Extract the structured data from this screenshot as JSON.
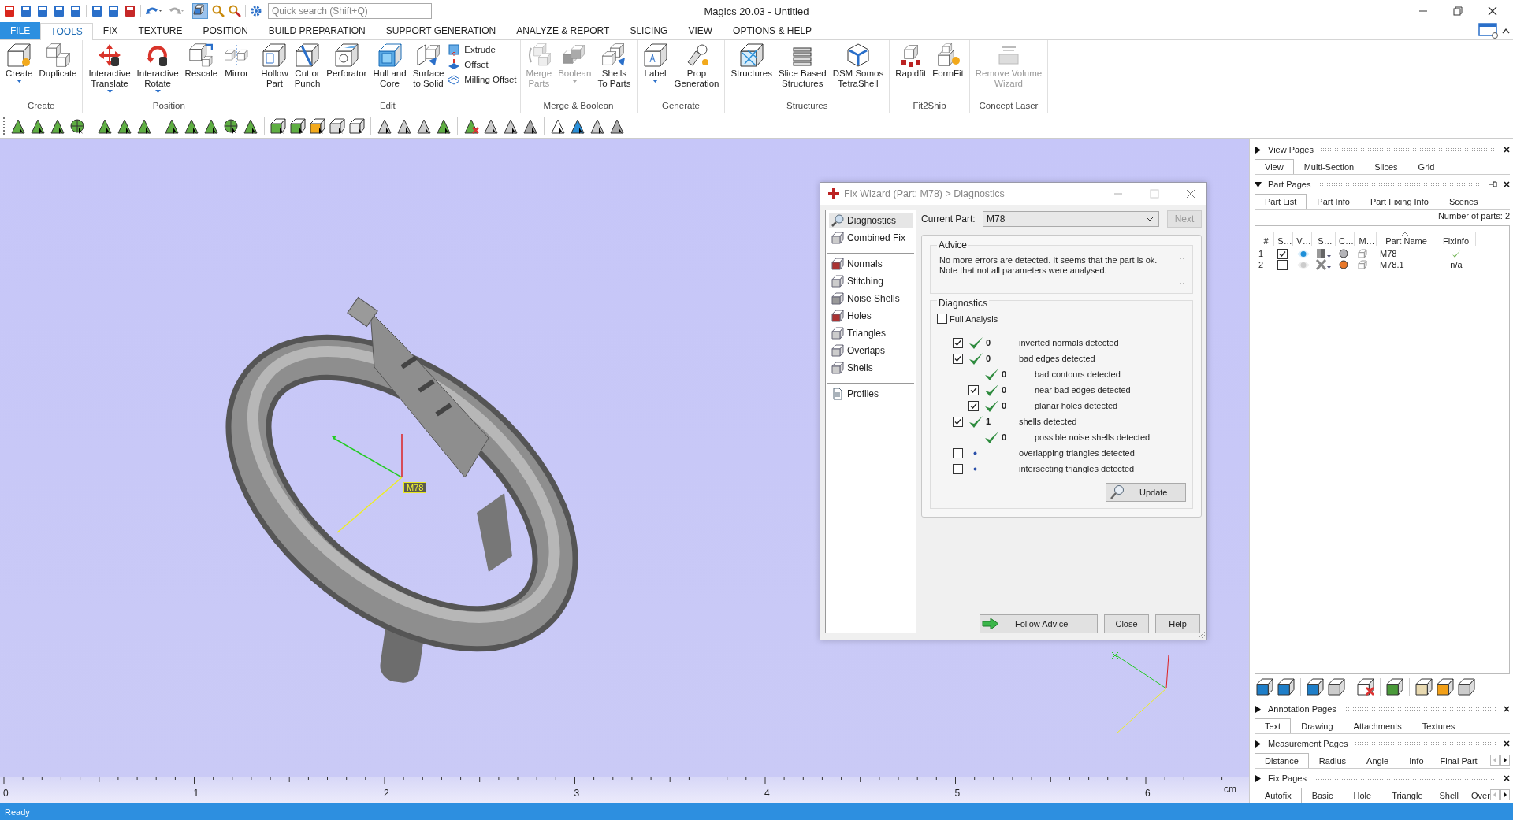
{
  "window": {
    "title": "Magics 20.03 - Untitled"
  },
  "quick_search": {
    "placeholder": "Quick search (Shift+Q)"
  },
  "menu_tabs": [
    {
      "label": "FILE",
      "kind": "file",
      "selected": false
    },
    {
      "label": "TOOLS",
      "kind": "tab",
      "selected": true
    },
    {
      "label": "FIX",
      "kind": "tab",
      "selected": false
    },
    {
      "label": "TEXTURE",
      "kind": "tab",
      "selected": false
    },
    {
      "label": "POSITION",
      "kind": "tab",
      "selected": false
    },
    {
      "label": "BUILD PREPARATION",
      "kind": "tab",
      "selected": false
    },
    {
      "label": "SUPPORT GENERATION",
      "kind": "tab",
      "selected": false
    },
    {
      "label": "ANALYZE & REPORT",
      "kind": "tab",
      "selected": false
    },
    {
      "label": "SLICING",
      "kind": "tab",
      "selected": false
    },
    {
      "label": "VIEW",
      "kind": "tab",
      "selected": false
    },
    {
      "label": "OPTIONS & HELP",
      "kind": "tab",
      "selected": false
    }
  ],
  "ribbon_groups": [
    {
      "label": "Create",
      "buttons": [
        {
          "label": "Create",
          "kind": "large",
          "dropdown": true,
          "disabled": false
        },
        {
          "label": "Duplicate",
          "kind": "large",
          "dropdown": false,
          "disabled": false
        }
      ]
    },
    {
      "label": "Position",
      "buttons": [
        {
          "label": "Interactive\nTranslate",
          "kind": "large",
          "dropdown": true,
          "disabled": false
        },
        {
          "label": "Interactive\nRotate",
          "kind": "large",
          "dropdown": true,
          "disabled": false
        },
        {
          "label": "Rescale",
          "kind": "large",
          "dropdown": false,
          "disabled": false
        },
        {
          "label": "Mirror",
          "kind": "large",
          "dropdown": false,
          "disabled": false
        }
      ]
    },
    {
      "label": "Edit",
      "buttons": [
        {
          "label": "Hollow\nPart",
          "kind": "large",
          "dropdown": false,
          "disabled": false
        },
        {
          "label": "Cut or\nPunch",
          "kind": "large",
          "dropdown": false,
          "disabled": false
        },
        {
          "label": "Perforator",
          "kind": "large",
          "dropdown": false,
          "disabled": false
        },
        {
          "label": "Hull and\nCore",
          "kind": "large",
          "dropdown": false,
          "disabled": false
        },
        {
          "label": "Surface\nto Solid",
          "kind": "large",
          "dropdown": false,
          "disabled": false
        },
        {
          "label": "Extrude",
          "kind": "small",
          "dropdown": false,
          "disabled": false
        },
        {
          "label": "Offset",
          "kind": "small",
          "dropdown": false,
          "disabled": false
        },
        {
          "label": "Milling Offset",
          "kind": "small",
          "dropdown": false,
          "disabled": false
        }
      ]
    },
    {
      "label": "Merge & Boolean",
      "buttons": [
        {
          "label": "Merge\nParts",
          "kind": "large",
          "dropdown": false,
          "disabled": true
        },
        {
          "label": "Boolean",
          "kind": "large",
          "dropdown": true,
          "disabled": true
        },
        {
          "label": "Shells\nTo Parts",
          "kind": "large",
          "dropdown": false,
          "disabled": false
        }
      ]
    },
    {
      "label": "Generate",
      "buttons": [
        {
          "label": "Label",
          "kind": "large",
          "dropdown": true,
          "disabled": false
        },
        {
          "label": "Prop\nGeneration",
          "kind": "large",
          "dropdown": false,
          "disabled": false
        }
      ]
    },
    {
      "label": "Structures",
      "buttons": [
        {
          "label": "Structures",
          "kind": "large",
          "dropdown": false,
          "disabled": false
        },
        {
          "label": "Slice Based\nStructures",
          "kind": "large",
          "dropdown": false,
          "disabled": false
        },
        {
          "label": "DSM Somos\nTetraShell",
          "kind": "large",
          "dropdown": false,
          "disabled": false
        }
      ]
    },
    {
      "label": "Fit2Ship",
      "buttons": [
        {
          "label": "Rapidfit",
          "kind": "large",
          "dropdown": false,
          "disabled": false
        },
        {
          "label": "FormFit",
          "kind": "large",
          "dropdown": false,
          "disabled": false
        }
      ]
    },
    {
      "label": "Concept Laser",
      "buttons": [
        {
          "label": "Remove Volume\nWizard",
          "kind": "large",
          "dropdown": false,
          "disabled": true
        }
      ]
    }
  ],
  "viewport": {
    "part_label": "M78",
    "ruler": {
      "labels": [
        "0",
        "1",
        "2",
        "3",
        "4",
        "5",
        "6"
      ],
      "unit": "cm"
    }
  },
  "fix_wizard": {
    "title": "Fix Wizard (Part: M78) > Diagnostics",
    "nav_groups": [
      [
        {
          "label": "Diagnostics",
          "selected": true
        },
        {
          "label": "Combined Fix",
          "selected": false
        }
      ],
      [
        {
          "label": "Normals",
          "selected": false
        },
        {
          "label": "Stitching",
          "selected": false
        },
        {
          "label": "Noise Shells",
          "selected": false
        },
        {
          "label": "Holes",
          "selected": false
        },
        {
          "label": "Triangles",
          "selected": false
        },
        {
          "label": "Overlaps",
          "selected": false
        },
        {
          "label": "Shells",
          "selected": false
        }
      ],
      [
        {
          "label": "Profiles",
          "selected": false
        }
      ]
    ],
    "current_part": {
      "label": "Current Part:",
      "value": "M78"
    },
    "next_button": {
      "label": "Next",
      "disabled": true
    },
    "advice": {
      "title": "Advice",
      "text": "No more errors are detected. It seems that the part is ok.\nNote that not all parameters were analysed."
    },
    "diagnostics": {
      "title": "Diagnostics",
      "full_analysis": {
        "label": "Full Analysis",
        "checked": false
      },
      "rows": [
        {
          "checked": true,
          "kind": "ok",
          "count": "0",
          "label": "inverted normals detected"
        },
        {
          "checked": true,
          "kind": "ok",
          "count": "0",
          "label": "bad edges detected",
          "children": [
            {
              "kind": "ok",
              "count": "0",
              "label": "bad contours detected"
            },
            {
              "checked": true,
              "kind": "ok",
              "count": "0",
              "label": "near bad edges detected"
            },
            {
              "checked": true,
              "kind": "ok",
              "count": "0",
              "label": "planar holes detected"
            }
          ]
        },
        {
          "checked": true,
          "kind": "ok",
          "count": "1",
          "label": "shells detected",
          "children": [
            {
              "kind": "ok",
              "count": "0",
              "label": "possible noise shells detected"
            }
          ]
        },
        {
          "checked": false,
          "kind": "pending",
          "label": "overlapping triangles detected"
        },
        {
          "checked": false,
          "kind": "pending",
          "label": "intersecting triangles detected"
        }
      ],
      "update_button": "Update"
    },
    "buttons": [
      "Follow Advice",
      "Close",
      "Help"
    ]
  },
  "view_pages": {
    "title": "View Pages",
    "expanded": false,
    "tabs": [
      {
        "label": "View",
        "selected": true
      },
      {
        "label": "Multi-Section",
        "selected": false
      },
      {
        "label": "Slices",
        "selected": false
      },
      {
        "label": "Grid",
        "selected": false
      }
    ]
  },
  "part_pages": {
    "title": "Part Pages",
    "expanded": true,
    "tabs": [
      {
        "label": "Part List",
        "selected": true
      },
      {
        "label": "Part Info",
        "selected": false
      },
      {
        "label": "Part Fixing Info",
        "selected": false
      },
      {
        "label": "Scenes",
        "selected": false
      }
    ],
    "part_count": "Number of parts: 2",
    "columns": [
      "#",
      "S…",
      "V…",
      "S…",
      "C…",
      "M…",
      "Part Name",
      "FixInfo"
    ],
    "rows": [
      {
        "index": "1",
        "checked": true,
        "visible": true,
        "shaded": true,
        "color": "#b4b4b8",
        "name": "M78",
        "fix_info": {
          "kind": "check"
        }
      },
      {
        "index": "2",
        "checked": false,
        "visible": false,
        "shaded": false,
        "color": "#e8782a",
        "name": "M78.1",
        "fix_info": {
          "kind": "text",
          "text": "n/a"
        }
      }
    ]
  },
  "annotation_pages": {
    "title": "Annotation Pages",
    "expanded": false,
    "tabs": [
      {
        "label": "Text",
        "selected": true
      },
      {
        "label": "Drawing",
        "selected": false
      },
      {
        "label": "Attachments",
        "selected": false
      },
      {
        "label": "Textures",
        "selected": false
      }
    ]
  },
  "measurement_pages": {
    "title": "Measurement Pages",
    "expanded": false,
    "tabs": [
      {
        "label": "Distance",
        "selected": true
      },
      {
        "label": "Radius",
        "selected": false
      },
      {
        "label": "Angle",
        "selected": false
      },
      {
        "label": "Info",
        "selected": false
      },
      {
        "label": "Final Part",
        "selected": false
      }
    ]
  },
  "fix_pages": {
    "title": "Fix Pages",
    "expanded": false,
    "tabs": [
      {
        "label": "Autofix",
        "selected": true
      },
      {
        "label": "Basic",
        "selected": false
      },
      {
        "label": "Hole",
        "selected": false
      },
      {
        "label": "Triangle",
        "selected": false
      },
      {
        "label": "Shell",
        "selected": false
      },
      {
        "label": "Over",
        "selected": false
      }
    ]
  },
  "status_bar": {
    "text": "Ready"
  }
}
